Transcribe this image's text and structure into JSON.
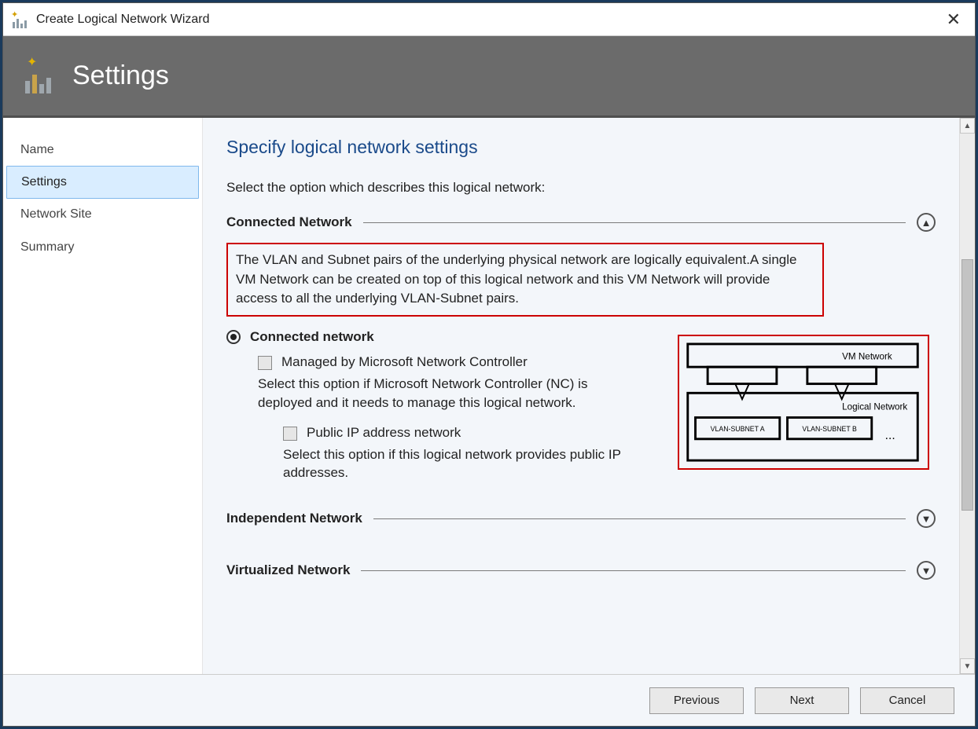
{
  "title": "Create Logical Network Wizard",
  "banner": "Settings",
  "sidebar": {
    "items": [
      "Name",
      "Settings",
      "Network Site",
      "Summary"
    ],
    "selected": 1
  },
  "main": {
    "heading": "Specify logical network settings",
    "subheading": "Select the option which describes this logical network:",
    "sections": {
      "connected": {
        "title": "Connected Network",
        "desc": "The VLAN and Subnet pairs of the underlying physical network are logically equivalent.A single VM Network can be created on top of this logical network and this VM Network will provide access to all the underlying VLAN-Subnet pairs.",
        "radio_label": "Connected network",
        "check1_label": "Managed by Microsoft Network Controller",
        "check1_desc": "Select this option if Microsoft Network Controller (NC) is deployed and it needs to manage this logical network.",
        "check2_label": "Public IP address network",
        "check2_desc": "Select this option if this logical network provides public IP addresses.",
        "diagram": {
          "vm_network": "VM Network",
          "logical_network": "Logical Network",
          "vlan_a": "VLAN-SUBNET A",
          "vlan_b": "VLAN-SUBNET B",
          "dots": "..."
        }
      },
      "independent": {
        "title": "Independent Network"
      },
      "virtualized": {
        "title": "Virtualized Network"
      }
    }
  },
  "footer": {
    "previous": "Previous",
    "next": "Next",
    "cancel": "Cancel"
  }
}
